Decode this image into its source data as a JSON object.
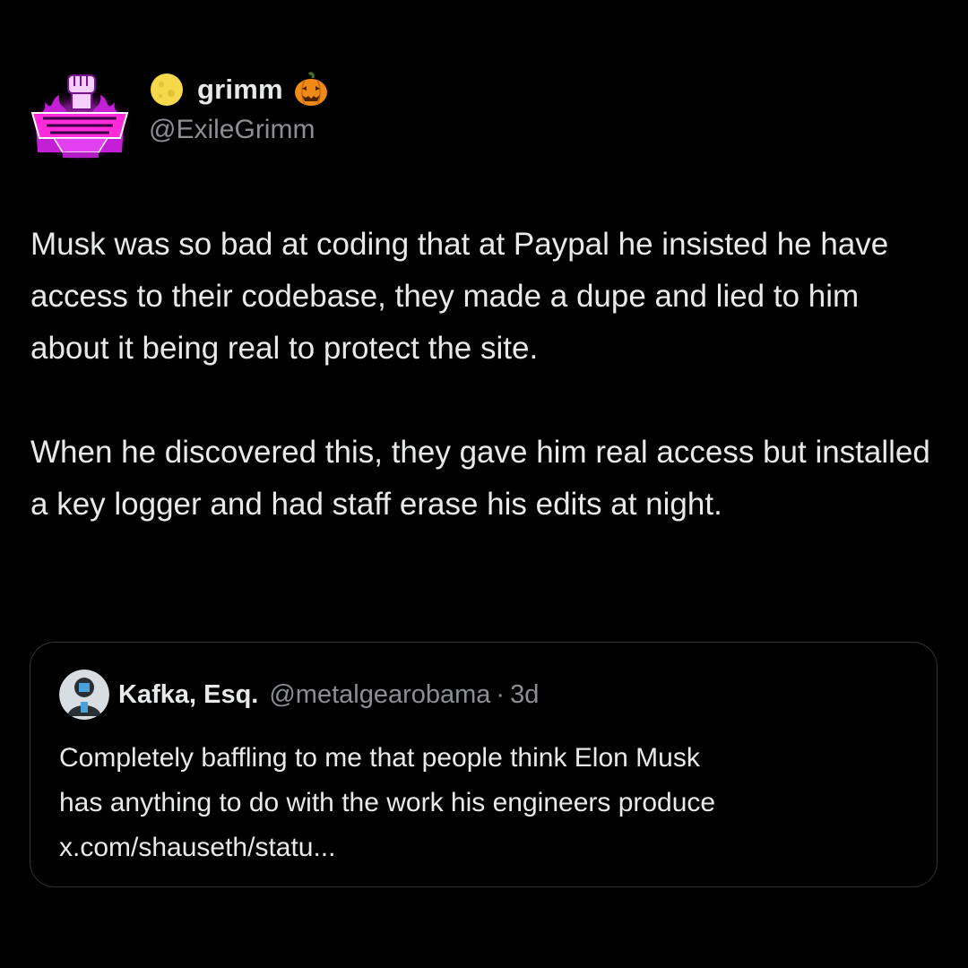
{
  "author": {
    "display_name": "grimm",
    "handle": "@ExileGrimm",
    "avatar_icon": "pink-raised-fist-logo-icon",
    "name_prefix_icon": "full-moon-emoji-icon",
    "name_suffix_icon": "jack-o-lantern-emoji-icon"
  },
  "body": {
    "paragraph_1": "Musk was so bad at coding that at Paypal he insisted he have access to their codebase, they made a dupe and lied to him about it being real to protect the site.",
    "paragraph_2": "When he discovered this, they gave him real access but installed a key logger and had staff erase his edits at night."
  },
  "quote": {
    "display_name": "Kafka, Esq.",
    "handle": "@metalgearobama",
    "separator": "·",
    "time": "3d",
    "avatar_icon": "user-avatar-icon",
    "text_lines": [
      "Completely baffling to me that people think Elon Musk",
      "has anything to do with the work his engineers produce",
      "x.com/shauseth/statu..."
    ]
  },
  "colors": {
    "background": "#000000",
    "text_primary": "#e7e9ea",
    "text_secondary": "#8b8f94",
    "quote_border": "#2f3336",
    "avatar_accent": "#e040fb"
  }
}
